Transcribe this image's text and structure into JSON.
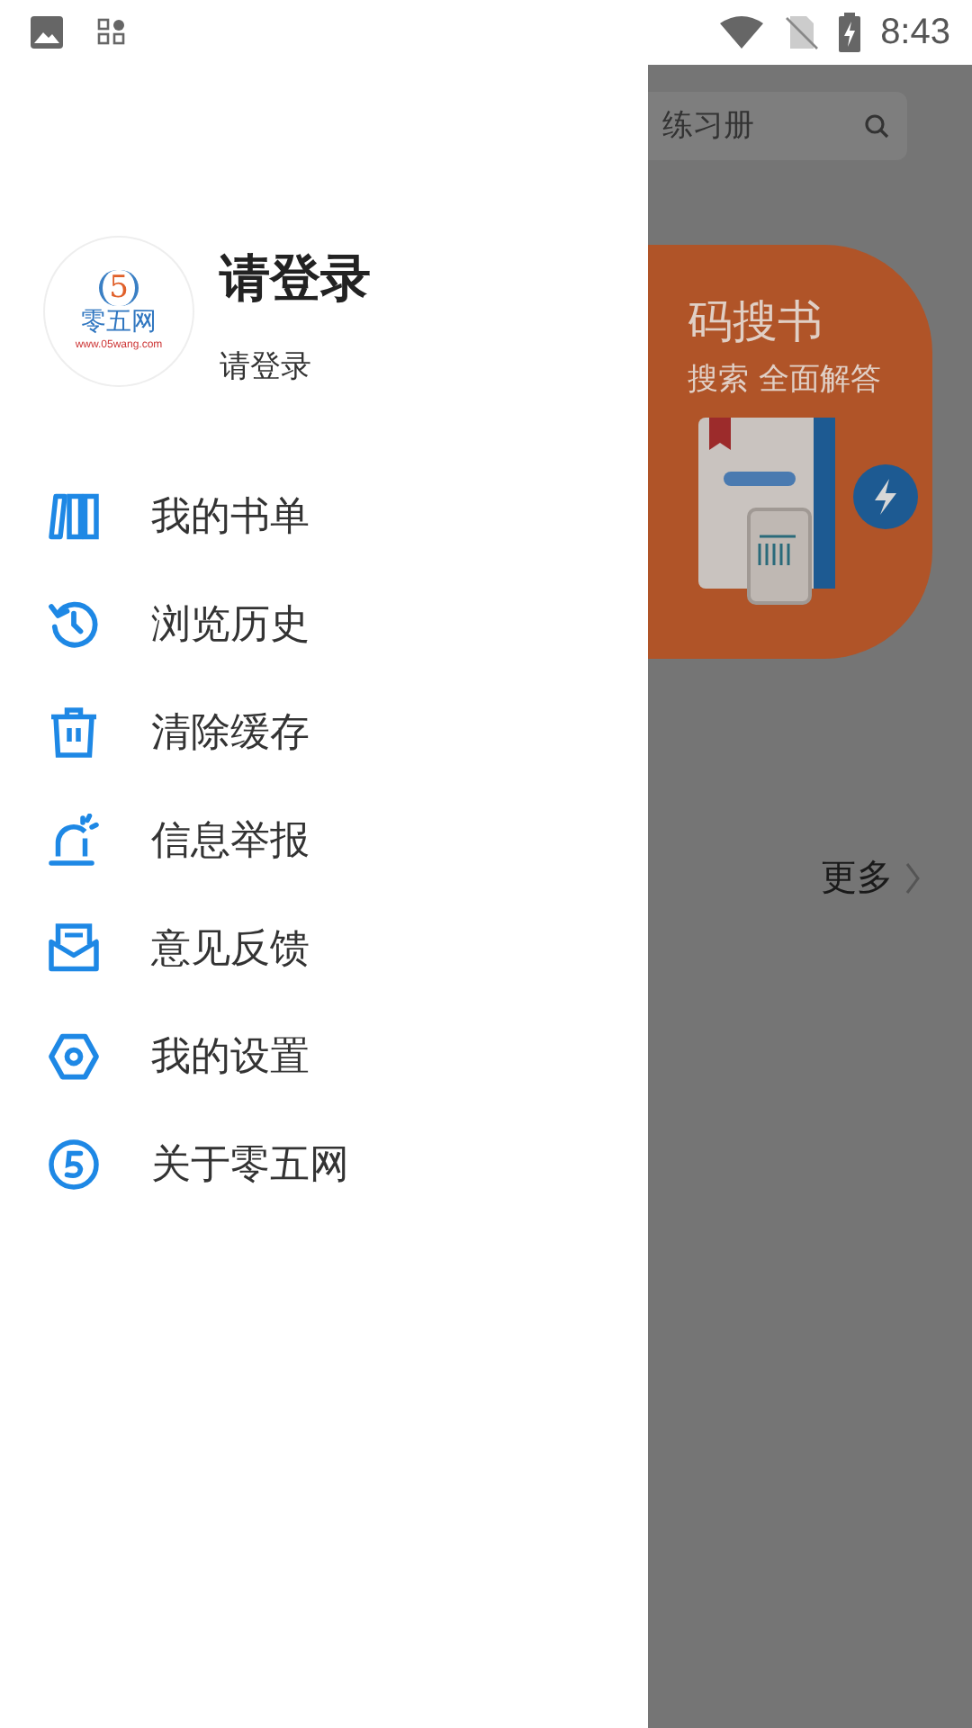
{
  "status_bar": {
    "time": "8:43"
  },
  "drawer": {
    "profile": {
      "logo": {
        "number": "5",
        "name": "零五网",
        "url": "www.05wang.com"
      },
      "title": "请登录",
      "subtitle": "请登录"
    },
    "menu": [
      {
        "kind": "books",
        "label": "我的书单"
      },
      {
        "kind": "history",
        "label": "浏览历史"
      },
      {
        "kind": "trash",
        "label": "清除缓存"
      },
      {
        "kind": "alarm",
        "label": "信息举报"
      },
      {
        "kind": "mail",
        "label": "意见反馈"
      },
      {
        "kind": "settings",
        "label": "我的设置"
      },
      {
        "kind": "about",
        "label": "关于零五网"
      }
    ]
  },
  "main": {
    "search": {
      "placeholder": "练习册"
    },
    "banner": {
      "title": "码搜书",
      "subtitle": "搜索 全面解答"
    },
    "more": "更多"
  }
}
